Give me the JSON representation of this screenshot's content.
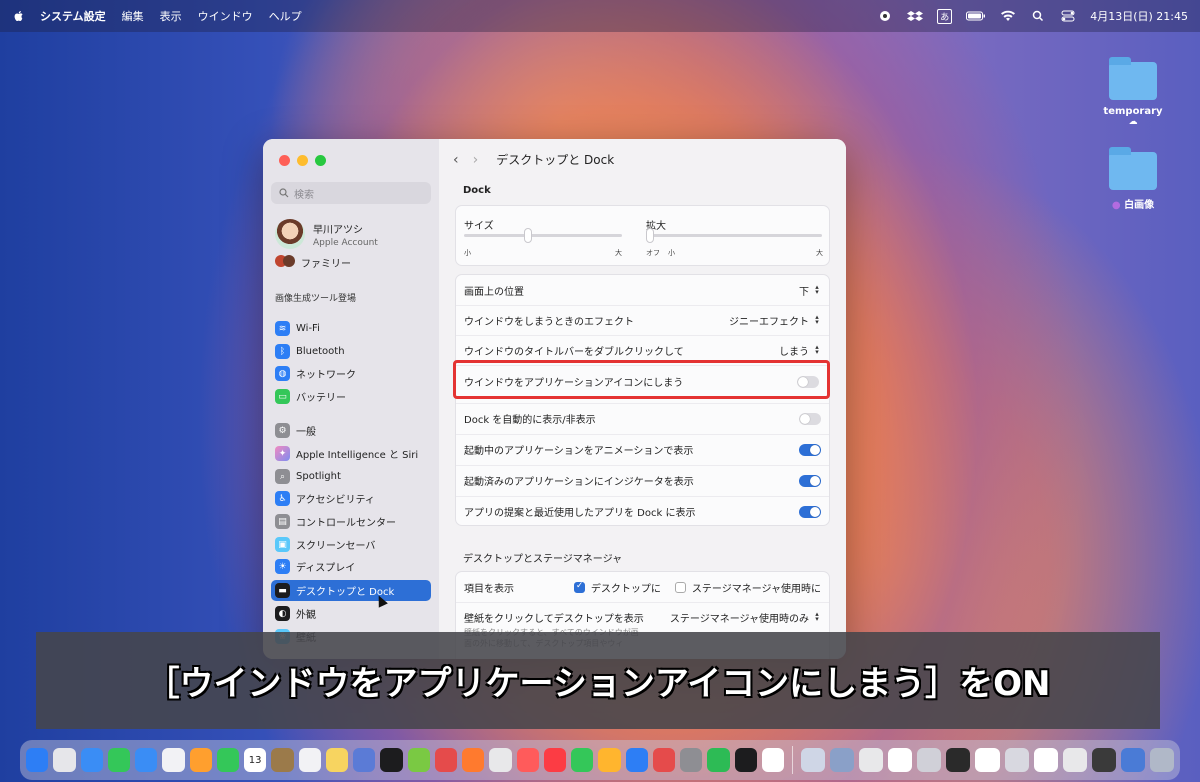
{
  "menubar": {
    "app": "システム設定",
    "items": [
      "編集",
      "表示",
      "ウインドウ",
      "ヘルプ"
    ],
    "input_mode": "あ",
    "datetime": "4月13日(日)  21:45"
  },
  "desktop": {
    "items": [
      {
        "label": "temporary"
      },
      {
        "label": "白画像"
      }
    ]
  },
  "window": {
    "search_placeholder": "検索",
    "profile": {
      "name": "早川アツシ",
      "sub": "Apple Account"
    },
    "family": "ファミリー",
    "section_label": "画像生成ツール登場",
    "sidebar": [
      {
        "label": "Wi-Fi",
        "color": "#2d7ef5",
        "icon": "wifi-icon"
      },
      {
        "label": "Bluetooth",
        "color": "#2d7ef5",
        "icon": "bluetooth-icon"
      },
      {
        "label": "ネットワーク",
        "color": "#2d7ef5",
        "icon": "globe-icon"
      },
      {
        "label": "バッテリー",
        "color": "#34c759",
        "icon": "battery-icon"
      },
      {
        "label": "一般",
        "color": "#8e8e93",
        "icon": "gear-icon"
      },
      {
        "label": "Apple Intelligence と Siri",
        "color": "#b57ee8",
        "icon": "siri-icon"
      },
      {
        "label": "Spotlight",
        "color": "#8e8e93",
        "icon": "spotlight-icon"
      },
      {
        "label": "アクセシビリティ",
        "color": "#2d7ef5",
        "icon": "accessibility-icon"
      },
      {
        "label": "コントロールセンター",
        "color": "#8e8e93",
        "icon": "control-center-icon"
      },
      {
        "label": "スクリーンセーバ",
        "color": "#5ac8fa",
        "icon": "screensaver-icon"
      },
      {
        "label": "ディスプレイ",
        "color": "#2d7ef5",
        "icon": "display-icon"
      },
      {
        "label": "デスクトップと Dock",
        "color": "#1c1c1e",
        "icon": "dock-icon"
      },
      {
        "label": "外観",
        "color": "#1c1c1e",
        "icon": "appearance-icon"
      },
      {
        "label": "壁紙",
        "color": "#5ac8fa",
        "icon": "wallpaper-icon"
      }
    ],
    "title": "デスクトップと Dock",
    "dock_section": "Dock",
    "size_label": "サイズ",
    "size_min": "小",
    "size_max": "大",
    "size_value": 0.4,
    "zoom_label": "拡大",
    "zoom_off": "オフ",
    "zoom_min": "小",
    "zoom_max": "大",
    "zoom_value": 0,
    "rows": [
      {
        "label": "画面上の位置",
        "value": "下"
      },
      {
        "label": "ウインドウをしまうときのエフェクト",
        "value": "ジニーエフェクト"
      },
      {
        "label": "ウインドウのタイトルバーをダブルクリックして",
        "value": "しまう"
      }
    ],
    "minimize_row": {
      "label": "ウインドウをアプリケーションアイコンにしまう",
      "on": false
    },
    "toggles": [
      {
        "label": "Dock を自動的に表示/非表示",
        "on": false
      },
      {
        "label": "起動中のアプリケーションをアニメーションで表示",
        "on": true
      },
      {
        "label": "起動済みのアプリケーションにインジケータを表示",
        "on": true
      },
      {
        "label": "アプリの提案と最近使用したアプリを Dock に表示",
        "on": true
      }
    ],
    "stage_section": "デスクトップとステージマネージャ",
    "show_items_label": "項目を表示",
    "show_desktop": "デスクトップに",
    "show_stage": "ステージマネージャ使用時に",
    "wallpaper_click_label": "壁紙をクリックしてデスクトップを表示",
    "wallpaper_click_value": "ステージマネージャ使用時のみ",
    "wallpaper_click_desc": "壁紙をクリックすると、すべてのウインドウが画面の外に移動して、デスクトップ項目やウィ"
  },
  "caption": "［ウインドウをアプリケーションアイコンにしまう］をON",
  "dock": {
    "calendar_day": "13",
    "apps": [
      "#2d7ef5",
      "#e6e6ea",
      "#3a8df5",
      "#34c759",
      "#3a8df5",
      "#f2f2f5",
      "#ff9f2e",
      "#34c759",
      "#ffffff",
      "#9b7a4a",
      "#f2f2f5",
      "#f7d460",
      "#5b7bd6",
      "#1c1c1e",
      "#7ac943",
      "#e54b4b",
      "#ff7a2e",
      "#e8e8ea",
      "#ff5b5b",
      "#fc3c44",
      "#34c759",
      "#ffb52e",
      "#2d7ef5",
      "#e54b4b",
      "#8e8e93",
      "#2dbb55",
      "#1c1c1e",
      "#ffffff"
    ],
    "right": [
      "#cfd6e6",
      "#8aa0c8",
      "#e8e8ea",
      "#ffffff",
      "#d0d0d8",
      "#2a2a2a",
      "#ffffff",
      "#d8d8e0",
      "#ffffff",
      "#e8e8ea",
      "#3a3a3a",
      "#4a7bd6",
      "#b0b8c8"
    ]
  }
}
